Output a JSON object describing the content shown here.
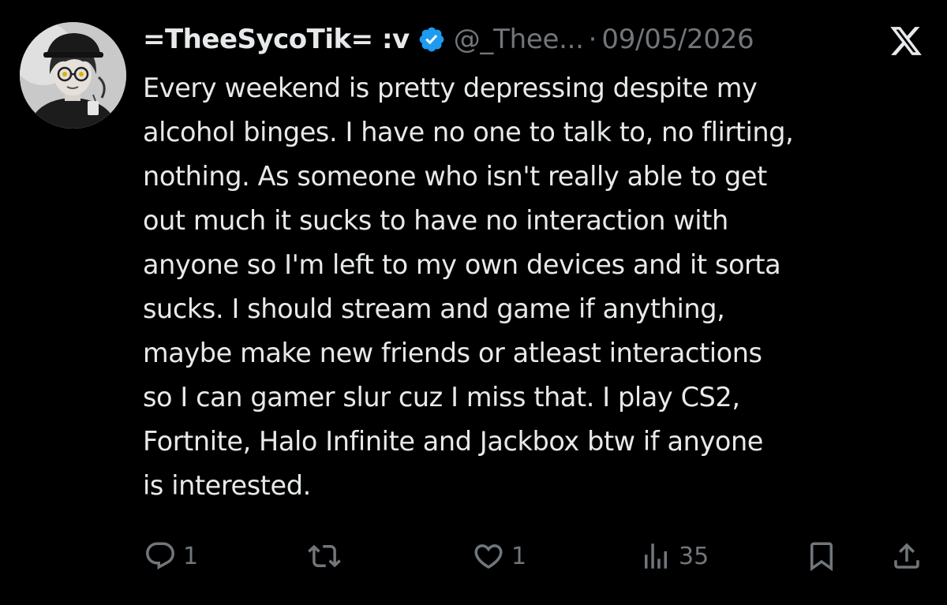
{
  "tweet": {
    "display_name": "=TheeSycoTik= :v",
    "handle": "@_Thee...",
    "separator": "·",
    "date": "09/05/2026",
    "body_lines": [
      "Every weekend is pretty depressing despite my",
      "alcohol binges.  I have no one to talk to, no flirting,",
      "nothing.  As someone who isn't really able to get",
      "out much it sucks to have no interaction with",
      "anyone so I'm left to my own devices and it sorta",
      "sucks.  I should stream and game if anything,",
      "maybe make new friends or atleast interactions",
      "so I can gamer slur cuz I miss that.  I play CS2,",
      "Fortnite, Halo Infinite and Jackbox btw if anyone",
      "is interested."
    ],
    "actions": {
      "replies": "1",
      "reposts": "",
      "likes": "1",
      "views": "35"
    }
  },
  "icons": {
    "verified": "verified-badge-icon",
    "platform": "x-logo-icon",
    "reply": "reply-icon",
    "repost": "repost-icon",
    "like": "heart-icon",
    "views": "views-chart-icon",
    "bookmark": "bookmark-icon",
    "share": "share-icon"
  },
  "colors": {
    "background": "#000000",
    "text_primary": "#e7e9ea",
    "text_secondary": "#71767b",
    "verified_blue": "#1d9bf0"
  }
}
